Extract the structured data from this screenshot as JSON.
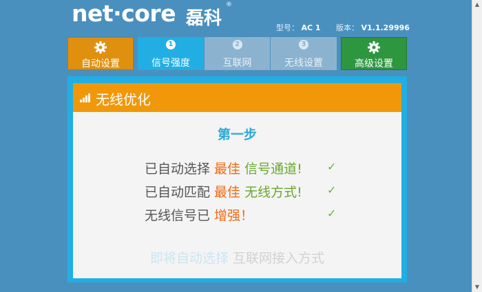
{
  "header": {
    "logo": "net·core",
    "logo_cn": "磊科",
    "reg_mark": "®",
    "model_label": "型号：",
    "model_value": "AC 1",
    "version_label": "版本：",
    "version_value": "V1.1.29996"
  },
  "nav": {
    "tabs": [
      {
        "label": "自动设置",
        "icon": "gear-icon"
      },
      {
        "label": "信号强度",
        "num": "1"
      },
      {
        "label": "互联网",
        "num": "2"
      },
      {
        "label": "无线设置",
        "num": "3"
      },
      {
        "label": "高级设置",
        "icon": "gear-icon"
      }
    ]
  },
  "panel": {
    "title": "无线优化",
    "step": "第一步",
    "rows": [
      {
        "prefix": "已自动选择 ",
        "emph": "最佳 ",
        "suffix": "信号通道!"
      },
      {
        "prefix": "已自动匹配 ",
        "emph": "最佳 ",
        "suffix": "无线方式!"
      },
      {
        "prefix": "无线信号已 ",
        "emph": "增强！",
        "suffix": ""
      }
    ],
    "check": "✓",
    "hint_highlight": "即将自动选择",
    "hint_rest": " 互联网接入方式"
  },
  "colors": {
    "background": "#4a90bf",
    "orange": "#f0980a",
    "blue": "#22aee2",
    "green": "#2f9640"
  }
}
